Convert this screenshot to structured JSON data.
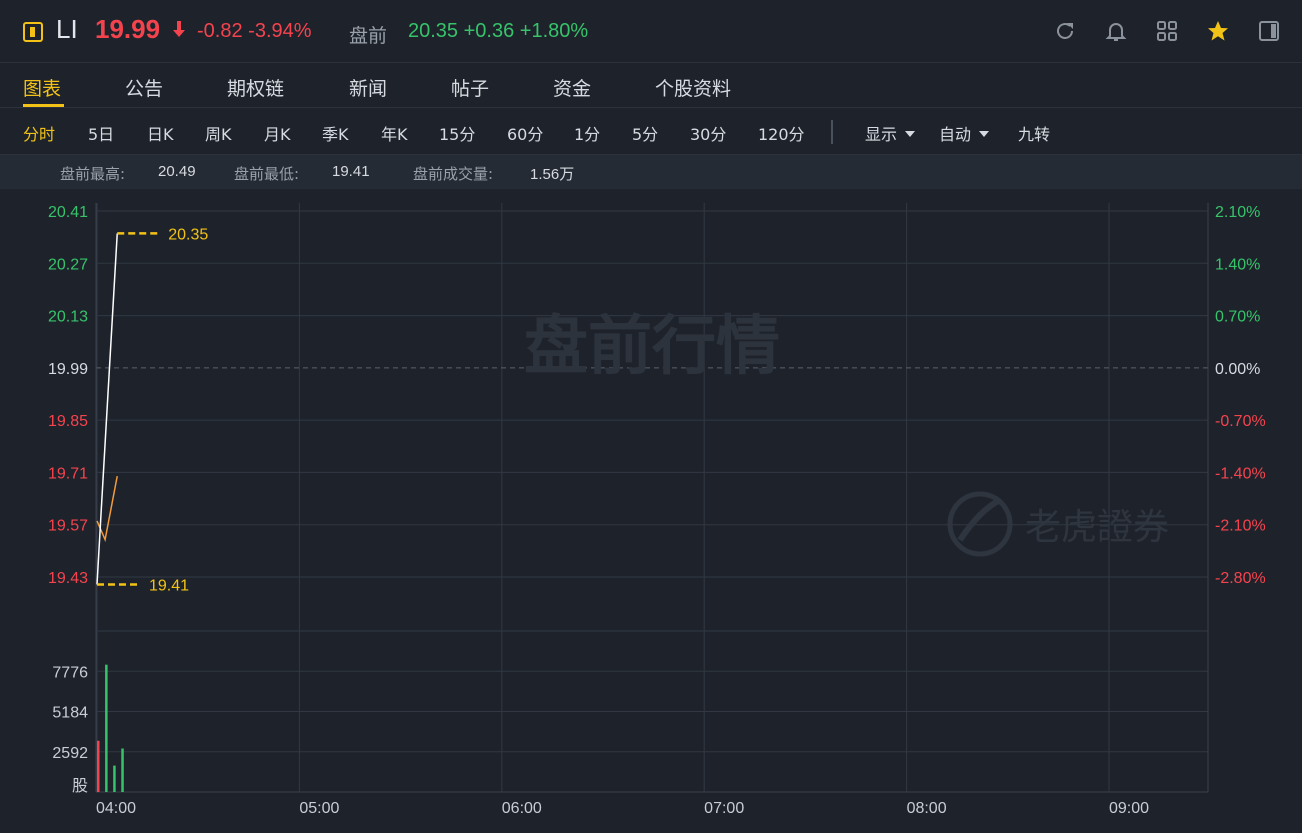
{
  "header": {
    "market_icon": "us-market-icon",
    "ticker": "LI",
    "price": "19.99",
    "change": "-0.82",
    "change_pct": "-3.94%",
    "premarket_label": "盘前",
    "premarket_price": "20.35",
    "premarket_change": "+0.36",
    "premarket_change_pct": "+1.80%",
    "icons": [
      "refresh-icon",
      "bell-icon",
      "grid-icon",
      "star-icon",
      "panel-icon"
    ]
  },
  "tabs": [
    {
      "label": "图表",
      "active": true
    },
    {
      "label": "公告"
    },
    {
      "label": "期权链"
    },
    {
      "label": "新闻"
    },
    {
      "label": "帖子"
    },
    {
      "label": "资金"
    },
    {
      "label": "个股资料"
    }
  ],
  "periods": [
    "分时",
    "5日",
    "日K",
    "周K",
    "月K",
    "季K",
    "年K",
    "15分",
    "60分",
    "1分",
    "5分",
    "30分",
    "120分"
  ],
  "active_period": "分时",
  "dropdowns": {
    "display": "显示",
    "auto": "自动"
  },
  "jiuzhuan": "九转",
  "stats": {
    "high_label": "盘前最高:",
    "high": "20.49",
    "low_label": "盘前最低:",
    "low": "19.41",
    "volume_label": "盘前成交量:",
    "volume": "1.56万"
  },
  "watermark": "盘前行情",
  "logo_text": "老虎證券",
  "colors": {
    "up": "#36c36a",
    "down": "#f5434e",
    "accent": "#f2c316",
    "line": "#ffffff",
    "avg": "#f39a3b"
  },
  "chart_data": {
    "type": "line",
    "price_axis": {
      "ticks": [
        "20.41",
        "20.27",
        "20.13",
        "19.99",
        "19.85",
        "19.71",
        "19.57",
        "19.43"
      ],
      "values": [
        20.41,
        20.27,
        20.13,
        19.99,
        19.85,
        19.71,
        19.57,
        19.43
      ],
      "ylim": [
        19.43,
        20.41
      ],
      "reference": 19.99
    },
    "percent_axis": {
      "ticks": [
        "2.10%",
        "1.40%",
        "0.70%",
        "0.00%",
        "-0.70%",
        "-1.40%",
        "-2.10%",
        "-2.80%"
      ]
    },
    "x_ticks": [
      "04:00",
      "05:00",
      "06:00",
      "07:00",
      "08:00",
      "09:00"
    ],
    "price_series": [
      {
        "t": 0.0,
        "v": 19.41
      },
      {
        "t": 0.02,
        "v": 19.6
      },
      {
        "t": 0.1,
        "v": 20.35
      }
    ],
    "avg_series": [
      {
        "t": 0.0,
        "v": 19.58
      },
      {
        "t": 0.04,
        "v": 19.53
      },
      {
        "t": 0.1,
        "v": 19.7
      }
    ],
    "high_marker": {
      "label": "20.35",
      "value": 20.35
    },
    "low_marker": {
      "label": "19.41",
      "value": 19.41
    },
    "volume_axis": {
      "ticks": [
        "7776",
        "5184",
        "2592"
      ],
      "values": [
        7776,
        5184,
        2592
      ],
      "unit": "股",
      "ymax": 10368
    },
    "volume_bars": [
      {
        "t": 0.0,
        "v": 3300,
        "dir": "down"
      },
      {
        "t": 0.04,
        "v": 8200,
        "dir": "up"
      },
      {
        "t": 0.08,
        "v": 1700,
        "dir": "up"
      },
      {
        "t": 0.12,
        "v": 2800,
        "dir": "up"
      }
    ]
  }
}
